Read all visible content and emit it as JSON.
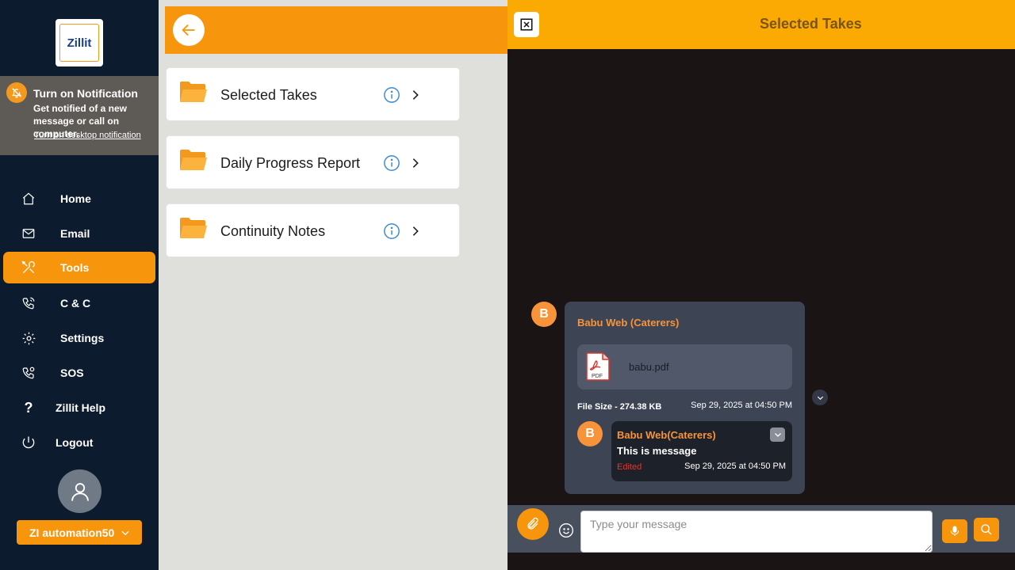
{
  "brand": {
    "logo_text": "Zillit"
  },
  "notification": {
    "title": "Turn on Notification",
    "text": "Get notified of a new message or call on computer.",
    "link": "Turn on desktop notification"
  },
  "nav": {
    "home": "Home",
    "email": "Email",
    "tools": "Tools",
    "cc": "C & C",
    "settings": "Settings",
    "sos": "SOS",
    "help": "Zillit Help",
    "logout": "Logout",
    "active": "Tools"
  },
  "user": {
    "name": "ZI automation50"
  },
  "folders": [
    {
      "label": "Selected Takes"
    },
    {
      "label": "Daily Progress Report"
    },
    {
      "label": "Continuity Notes"
    }
  ],
  "panel": {
    "title": "Selected Takes"
  },
  "message": {
    "avatar_letter": "B",
    "sender": "Babu Web (Caterers)",
    "file_name": "babu.pdf",
    "pdf_badge": "PDF",
    "file_size": "File Size - 274.38 KB",
    "time": "Sep 29, 2025 at 04:50 PM",
    "reply": {
      "avatar_letter": "B",
      "sender": "Babu Web(Caterers)",
      "text": "This is message",
      "edited": "Edited",
      "time": "Sep 29, 2025 at 04:50 PM"
    }
  },
  "composer": {
    "placeholder": "Type your message"
  },
  "colors": {
    "accent": "#f7950d",
    "sidebar": "#0d1b2e",
    "header": "#fbaa04"
  }
}
